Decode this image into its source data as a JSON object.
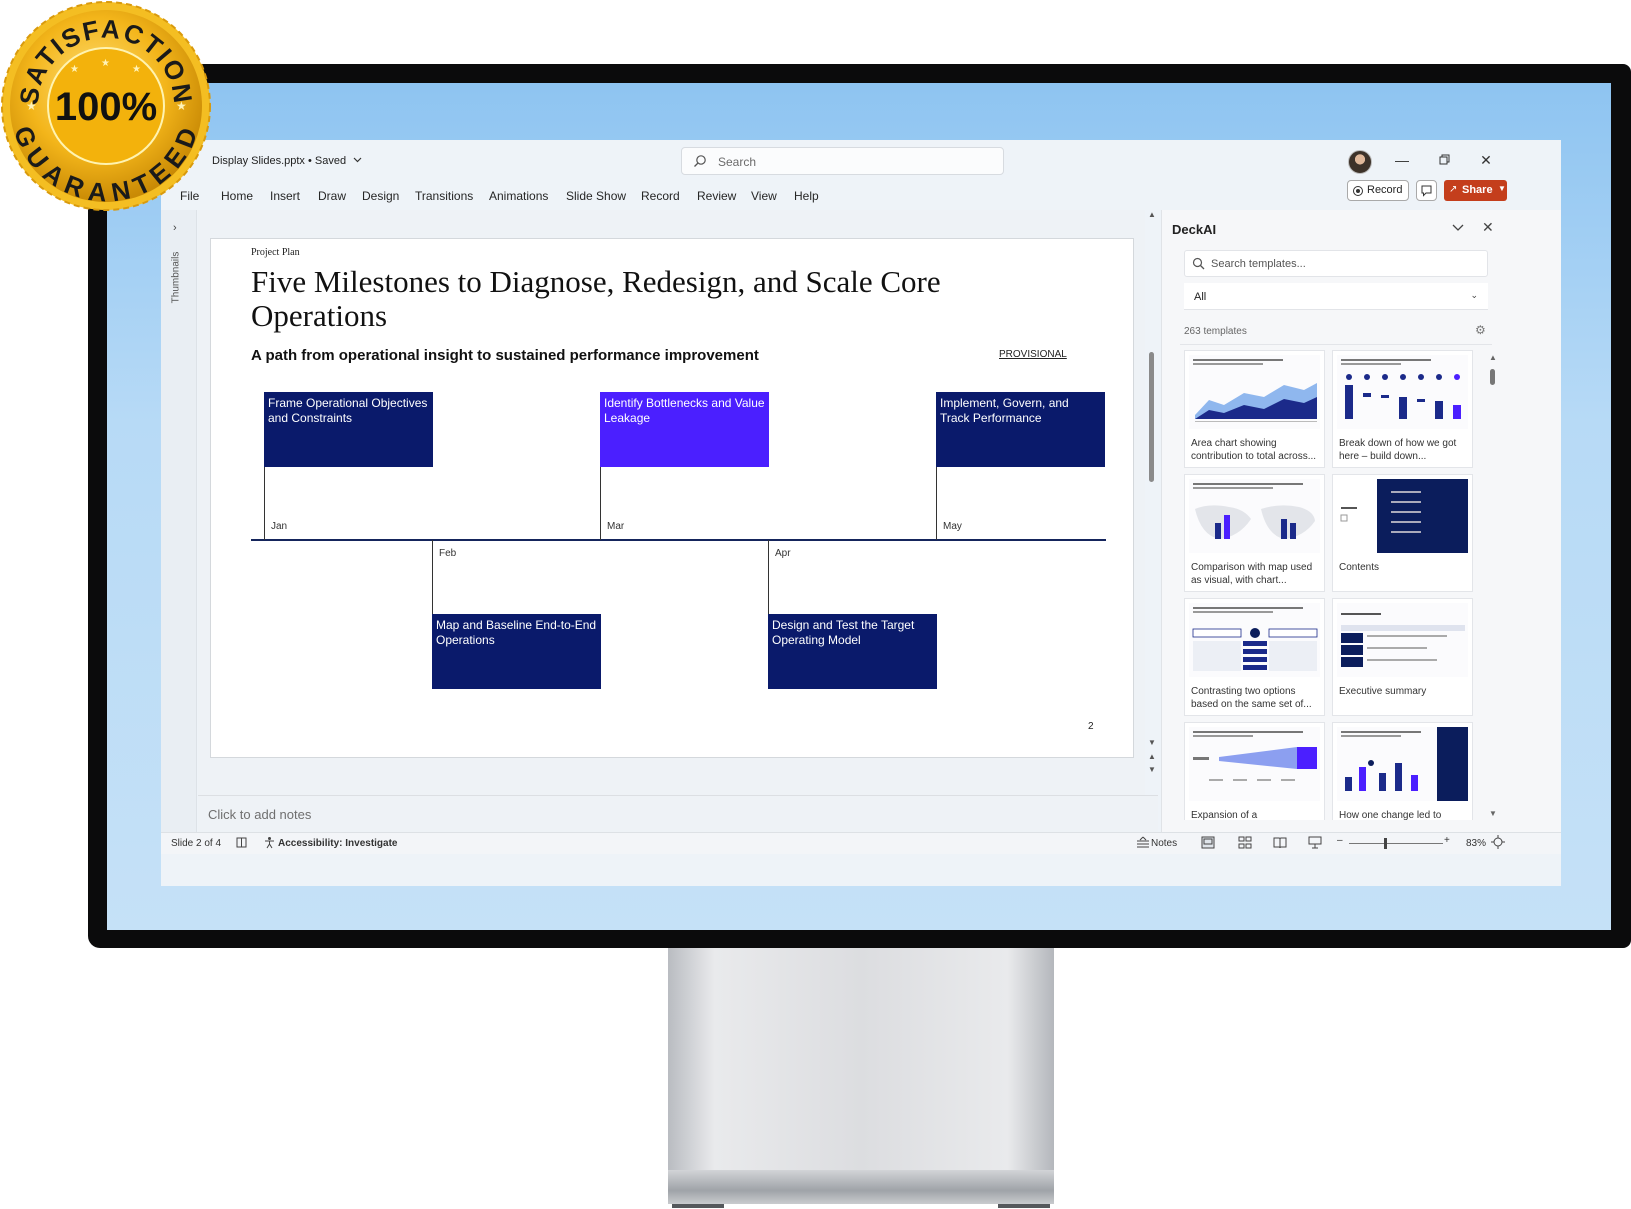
{
  "badge": {
    "top_text": "SATISFACTION",
    "percent": "100%",
    "bottom_text": "GUARANTEED"
  },
  "app": {
    "doc_title": "Display Slides.pptx",
    "save_status": "Saved",
    "search_placeholder": "Search",
    "window_controls": [
      "minimize-icon",
      "restore-icon",
      "close-icon"
    ]
  },
  "menu": {
    "items": [
      "File",
      "Home",
      "Insert",
      "Draw",
      "Design",
      "Transitions",
      "Animations",
      "Slide Show",
      "Record",
      "Review",
      "View",
      "Help"
    ],
    "record_label": "Record",
    "share_label": "Share",
    "share_color": "#c43e1c"
  },
  "thumbnails_label": "Thumbnails",
  "slide": {
    "eyebrow": "Project Plan",
    "title": "Five Milestones to Diagnose, Redesign, and Scale Core Operations",
    "subtitle": "A path from operational insight to sustained performance improvement",
    "provisional": "PROVISIONAL",
    "page_number": "2",
    "milestones": [
      {
        "month": "Jan",
        "label": "Frame Operational Objectives and Constraints",
        "color": "#0a1a6b"
      },
      {
        "month": "Feb",
        "label": "Map and Baseline End-to-End Operations",
        "color": "#0a1a6b"
      },
      {
        "month": "Mar",
        "label": "Identify Bottlenecks and Value Leakage",
        "color": "#4b1fff"
      },
      {
        "month": "Apr",
        "label": "Design and Test the Target Operating Model",
        "color": "#0a1a6b"
      },
      {
        "month": "May",
        "label": "Implement, Govern, and Track Performance",
        "color": "#0a1a6b"
      }
    ]
  },
  "notes_placeholder": "Click to add notes",
  "status": {
    "slide_indicator": "Slide 2 of 4",
    "accessibility": "Accessibility: Investigate",
    "notes_label": "Notes",
    "zoom": "83%"
  },
  "panel": {
    "title": "DeckAI",
    "search_placeholder": "Search templates...",
    "filter_value": "All",
    "count": "263 templates",
    "templates": [
      {
        "caption": "Area chart showing contribution to total across..."
      },
      {
        "caption": "Break down of how we got here – build down..."
      },
      {
        "caption": "Comparison with map used as visual, with chart..."
      },
      {
        "caption": "Contents"
      },
      {
        "caption": "Contrasting two options based on the same set of..."
      },
      {
        "caption": "Executive summary"
      },
      {
        "caption": "Expansion of a"
      },
      {
        "caption": "How one change led to"
      }
    ]
  }
}
